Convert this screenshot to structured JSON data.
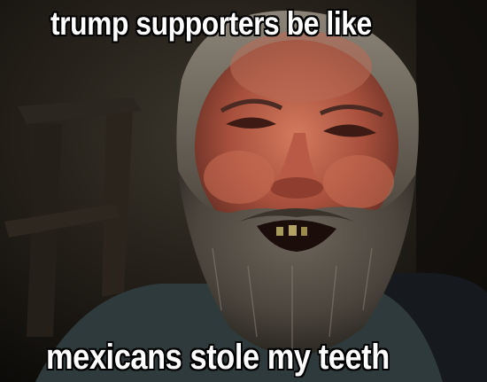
{
  "meme": {
    "top_text": "trump supporters be like",
    "bottom_text": "mexicans stole my teeth"
  },
  "colors": {
    "caption_fill": "#ffffff",
    "caption_outline": "#000000"
  }
}
